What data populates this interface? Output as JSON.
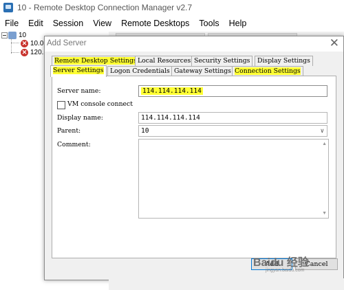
{
  "window": {
    "title": "10 - Remote Desktop Connection Manager v2.7"
  },
  "menu": [
    "File",
    "Edit",
    "Session",
    "View",
    "Remote Desktops",
    "Tools",
    "Help"
  ],
  "tree": {
    "group": "10",
    "servers": [
      "10.0",
      "120."
    ]
  },
  "dialog": {
    "title": "Add Server",
    "tabs_row1": [
      "Remote Desktop Settings",
      "Local Resources",
      "Security Settings",
      "Display Settings"
    ],
    "tabs_row2": [
      "Server Settings",
      "Logon Credentials",
      "Gateway Settings",
      "Connection Settings"
    ],
    "active_tab": "Server Settings",
    "server_name_label": "Server name:",
    "server_name_value": "114.114.114.114",
    "vm_console_label": "VM console connect",
    "vm_console_checked": false,
    "display_name_label": "Display name:",
    "display_name_value": "114.114.114.114",
    "parent_label": "Parent:",
    "parent_value": "10",
    "comment_label": "Comment:",
    "comment_value": "",
    "add_button": "Add",
    "cancel_button": "Cancel"
  },
  "watermark": {
    "main": "Baidu 经验",
    "sub": "jingyan.baidu.com"
  },
  "colors": {
    "highlight": "#ffff33",
    "error_icon": "#c8332d",
    "accent": "#0078d7"
  }
}
